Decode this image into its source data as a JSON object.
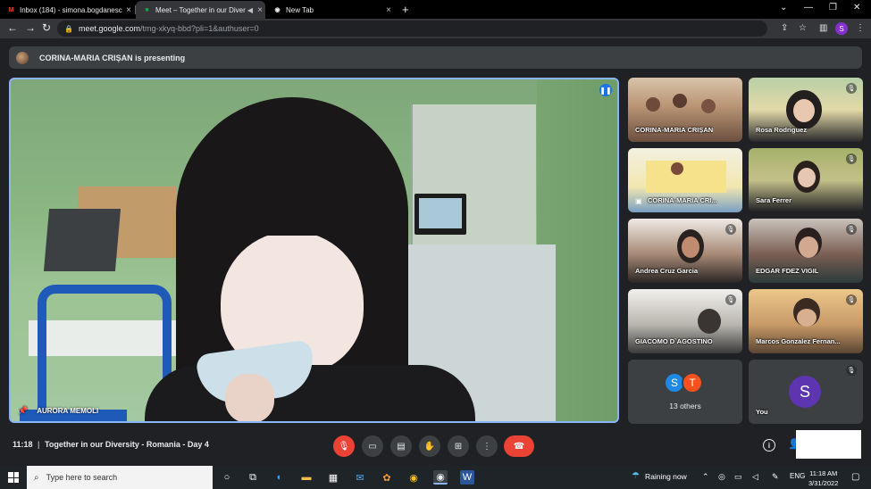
{
  "browser": {
    "tabs": [
      {
        "title": "Inbox (184) - simona.bogdanesc",
        "favicon": "gmail-icon",
        "favicon_color": "#ea4335"
      },
      {
        "title": "Meet – Together in our Divers",
        "favicon": "meet-icon",
        "audio": true,
        "active": true
      },
      {
        "title": "New Tab",
        "favicon": "chrome-icon"
      }
    ],
    "url_host": "meet.google.com",
    "url_path": "/tmg-xkyq-bbd?pli=1&authuser=0",
    "profile_initial": "S"
  },
  "banner": {
    "text": "CORINA-MARIA CRIȘAN is presenting"
  },
  "main_tile": {
    "name": "AURORA MEMOLI",
    "accent": "#8ab4f8"
  },
  "grid": [
    {
      "name": "CORINA-MARIA CRIȘAN",
      "muted": false
    },
    {
      "name": "Rosa Rodriguez",
      "muted": true
    },
    {
      "name": "CORINA-MARIA CRI...",
      "muted": false,
      "presentation": true
    },
    {
      "name": "Sara Ferrer",
      "muted": true
    },
    {
      "name": "Andrea Cruz Garcia",
      "muted": true
    },
    {
      "name": "EDGAR FDEZ VIGIL",
      "muted": true
    },
    {
      "name": "GIACOMO D`AGOSTINO",
      "muted": true
    },
    {
      "name": "Marcos Gonzalez Fernan...",
      "muted": true
    }
  ],
  "others": {
    "avatars": [
      {
        "initial": "S",
        "color": "#1e88e5"
      },
      {
        "initial": "T",
        "color": "#f4511e"
      }
    ],
    "label": "13 others"
  },
  "you": {
    "initial": "S",
    "label": "You"
  },
  "controls": {
    "time": "11:18",
    "separator": "|",
    "meeting_title": "Together in our Diversity - Romania - Day 4"
  },
  "taskbar": {
    "search_placeholder": "Type here to search",
    "weather": "Raining now",
    "language": "ENG",
    "time": "11:18 AM",
    "date": "3/31/2022"
  },
  "colors": {
    "end_call": "#ea4335",
    "speaking": "#1a73e8"
  }
}
